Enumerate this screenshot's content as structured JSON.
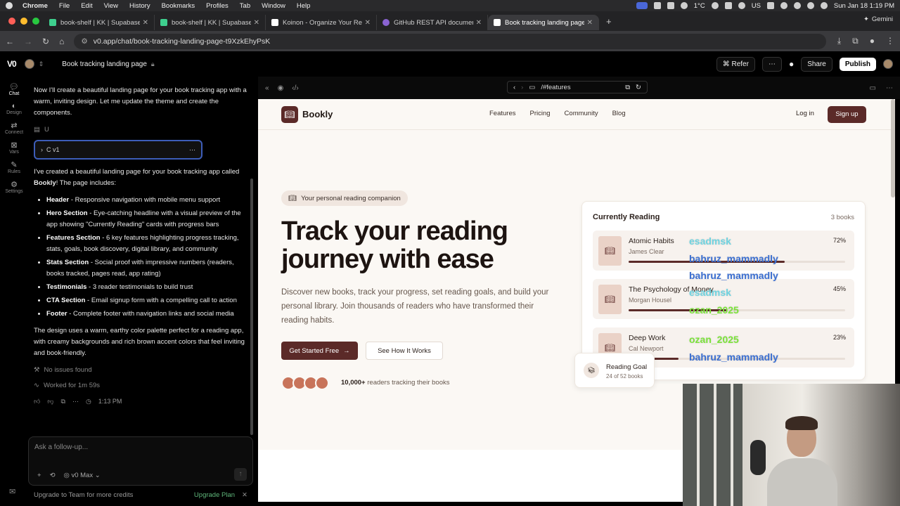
{
  "menubar": {
    "app": "Chrome",
    "items": [
      "File",
      "Edit",
      "View",
      "History",
      "Bookmarks",
      "Profiles",
      "Tab",
      "Window",
      "Help"
    ],
    "temperature": "1°C",
    "input_source": "US",
    "datetime": "Sun Jan 18  1:19 PM"
  },
  "tabs": [
    {
      "label": "book-shelf | KK | Supabase",
      "color": "#3ecf8e"
    },
    {
      "label": "book-shelf | KK | Supabase",
      "color": "#3ecf8e"
    },
    {
      "label": "Koinon - Organize Your Readi",
      "color": "#222222"
    },
    {
      "label": "GitHub REST API documentati",
      "color": "#8a63d2"
    },
    {
      "label": "Book tracking landing page",
      "color": "#ffffff"
    }
  ],
  "browser": {
    "url": "v0.app/chat/book-tracking-landing-page-t9XzkEhyPsK",
    "gemini": "Gemini"
  },
  "v0": {
    "logo": "V0",
    "project_title": "Book tracking landing page",
    "refer": "Refer",
    "share": "Share",
    "publish": "Publish"
  },
  "rail": [
    {
      "label": "Chat",
      "icon": "chat-icon"
    },
    {
      "label": "Design",
      "icon": "design-icon"
    },
    {
      "label": "Connect",
      "icon": "connect-icon"
    },
    {
      "label": "Vars",
      "icon": "vars-icon"
    },
    {
      "label": "Rules",
      "icon": "rules-icon"
    },
    {
      "label": "Settings",
      "icon": "settings-icon"
    }
  ],
  "chat": {
    "intro": "Now I'll create a beautiful landing page for your book tracking app with a warm, inviting design. Let me update the theme and create the components.",
    "file_marker": "U",
    "version_label": "C v1",
    "summary_intro_pre": "I've created a beautiful landing page for your book tracking app called ",
    "summary_intro_brand": "Bookly",
    "summary_intro_post": "! The page includes:",
    "features": [
      {
        "title": "Header",
        "desc": " - Responsive navigation with mobile menu support"
      },
      {
        "title": "Hero Section",
        "desc": " - Eye-catching headline with a visual preview of the app showing \"Currently Reading\" cards with progress bars"
      },
      {
        "title": "Features Section",
        "desc": " - 6 key features highlighting progress tracking, stats, goals, book discovery, digital library, and community"
      },
      {
        "title": "Stats Section",
        "desc": " - Social proof with impressive numbers (readers, books tracked, pages read, app rating)"
      },
      {
        "title": "Testimonials",
        "desc": " - 3 reader testimonials to build trust"
      },
      {
        "title": "CTA Section",
        "desc": " - Email signup form with a compelling call to action"
      },
      {
        "title": "Footer",
        "desc": " - Complete footer with navigation links and social media"
      }
    ],
    "closing": "The design uses a warm, earthy color palette perfect for a reading app, with creamy backgrounds and rich brown accent colors that feel inviting and book-friendly.",
    "no_issues": "No issues found",
    "worked_for": "Worked for 1m 59s",
    "time": "1:13 PM",
    "followup_placeholder": "Ask a follow-up...",
    "model": "v0 Max",
    "upgrade_text": "Upgrade to Team for more credits",
    "upgrade_link": "Upgrade Plan"
  },
  "preview": {
    "route": "/#features"
  },
  "site": {
    "brand": "Bookly",
    "nav": [
      "Features",
      "Pricing",
      "Community",
      "Blog"
    ],
    "login": "Log in",
    "signup": "Sign up",
    "pill": "Your personal reading companion",
    "headline": "Track your reading journey with ease",
    "subtext": "Discover new books, track your progress, set reading goals, and build your personal library. Join thousands of readers who have transformed their reading habits.",
    "cta_primary": "Get Started Free",
    "cta_secondary": "See How It Works",
    "social_count": "10,000+",
    "social_text": " readers tracking their books",
    "card_title": "Currently Reading",
    "card_count": "3 books",
    "books": [
      {
        "title": "Atomic Habits",
        "author": "James Clear",
        "pct": "72%",
        "progress": 0.72
      },
      {
        "title": "The Psychology of Money",
        "author": "Morgan Housel",
        "pct": "45%",
        "progress": 0.45
      },
      {
        "title": "Deep Work",
        "author": "Cal Newport",
        "pct": "23%",
        "progress": 0.23
      }
    ],
    "goal_title": "Reading Goal",
    "goal_sub": "24 of 52 books",
    "accent": "#5b2a28",
    "background": "#fbf8f4"
  },
  "overlay_names": [
    {
      "text": "esadmsk",
      "color": "lightblue"
    },
    {
      "text": "bahruz_mammadly",
      "color": "blue"
    },
    {
      "text": "bahruz_mammadly",
      "color": "blue"
    },
    {
      "text": "esadmsk",
      "color": "lightblue"
    },
    {
      "text": "ozan_2025",
      "color": "green"
    },
    {
      "text": "ozan_2025",
      "color": "green"
    },
    {
      "text": "bahruz_mammadly",
      "color": "blue"
    }
  ]
}
